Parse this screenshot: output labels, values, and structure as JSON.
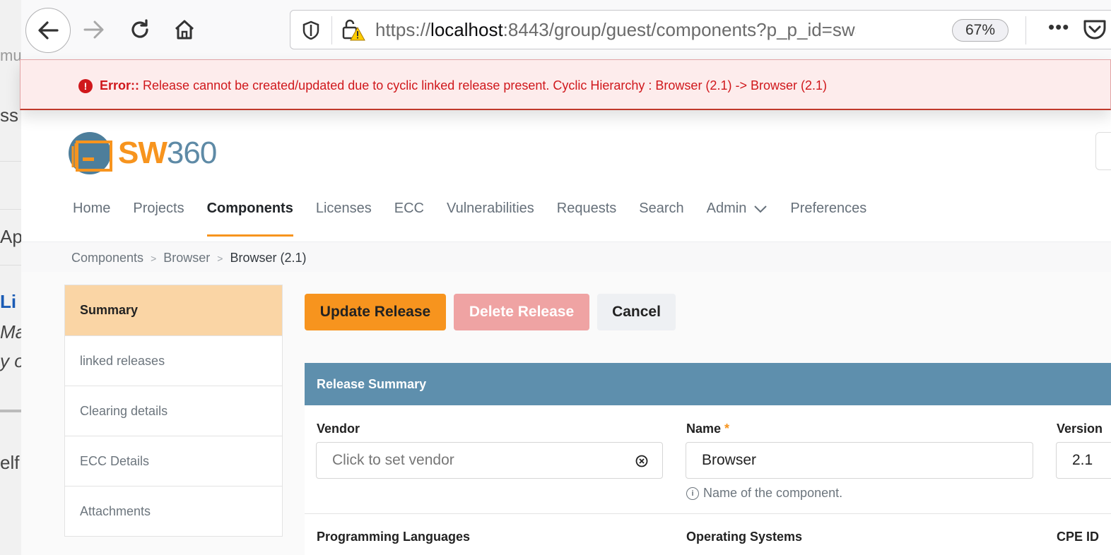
{
  "background_window": {
    "fragments": [
      "mu",
      "ss",
      "Ap",
      "Li",
      "Ma",
      "y o",
      "elf"
    ]
  },
  "browser": {
    "url_prefix": "https://",
    "url_host": "localhost",
    "url_rest": ":8443/group/guest/components?p_p_id=sw360",
    "zoom": "67%",
    "more_glyph": "•••"
  },
  "error": {
    "label": "Error::",
    "message": "Release cannot be created/updated due to cyclic linked release present. Cyclic Hierarchy : Browser (2.1) -> Browser (2.1)"
  },
  "logo": {
    "sw": "SW",
    "num": "360"
  },
  "nav": {
    "items": [
      {
        "label": "Home"
      },
      {
        "label": "Projects"
      },
      {
        "label": "Components"
      },
      {
        "label": "Licenses"
      },
      {
        "label": "ECC"
      },
      {
        "label": "Vulnerabilities"
      },
      {
        "label": "Requests"
      },
      {
        "label": "Search"
      },
      {
        "label": "Admin"
      },
      {
        "label": "Preferences"
      }
    ],
    "active": "Components"
  },
  "breadcrumb": [
    "Components",
    "Browser",
    "Browser (2.1)"
  ],
  "sidebar": {
    "items": [
      {
        "label": "Summary"
      },
      {
        "label": "linked releases"
      },
      {
        "label": "Clearing details"
      },
      {
        "label": "ECC Details"
      },
      {
        "label": "Attachments"
      }
    ],
    "active": "Summary"
  },
  "actions": {
    "update": "Update Release",
    "delete": "Delete Release",
    "cancel": "Cancel"
  },
  "panel": {
    "title": "Release Summary",
    "vendor": {
      "label": "Vendor",
      "placeholder": "Click to set vendor"
    },
    "name": {
      "label": "Name",
      "required_mark": "*",
      "value": "Browser",
      "hint": "Name of the component."
    },
    "version": {
      "label": "Version",
      "value": "2.1"
    },
    "programming_languages": {
      "label": "Programming Languages"
    },
    "operating_systems": {
      "label": "Operating Systems"
    },
    "cpe_id": {
      "label": "CPE ID"
    }
  },
  "colors": {
    "brand_orange": "#f7941e",
    "panel_blue": "#5e8fad",
    "error_red": "#d0181c"
  }
}
